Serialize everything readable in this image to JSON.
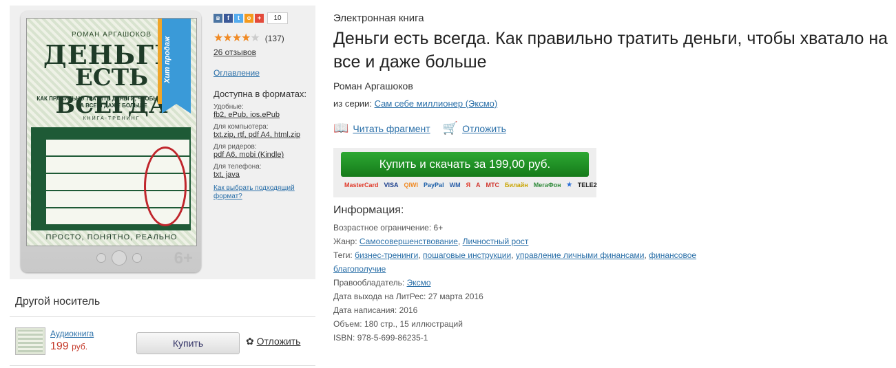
{
  "cover": {
    "author": "РОМАН АРГАШОКОВ",
    "title_line1": "ДЕНЬГИ",
    "title_line2": "ЕСТЬ ВСЕГДА",
    "subtitle": "КАК ПРАВИЛЬНО ТРАТИТЬ ДЕНЬГИ, ЧТОБЫ ХВАТАЛО НА ВСЕ И ДАЖЕ БОЛЬШЕ",
    "kind": "КНИГА-ТРЕНИНГ",
    "motto": "ПРОСТО, ПОНЯТНО, РЕАЛЬНО",
    "ribbon": "Хит продаж",
    "age": "6+"
  },
  "share": {
    "count": "10"
  },
  "rating": {
    "count": "(137)",
    "reviews": "26 отзывов"
  },
  "toc": "Оглавление",
  "formats": {
    "title": "Доступна в форматах:",
    "convenient_label": "Удобные:",
    "convenient": "fb2, ePub, ios.ePub",
    "computer_label": "Для компьютера:",
    "computer": "txt.zip, rtf, pdf A4, html.zip",
    "reader_label": "Для ридеров:",
    "reader": "pdf A6, mobi (Kindle)",
    "phone_label": "Для телефона:",
    "phone": "txt, java",
    "howto": "Как выбрать подходящий формат?"
  },
  "other_media": {
    "title": "Другой носитель",
    "audio_link": "Аудиокнига",
    "audio_price": "199",
    "audio_currency": "руб.",
    "buy_label": "Купить",
    "defer_label": "Отложить"
  },
  "book": {
    "type": "Электронная книга",
    "title": "Деньги есть всегда. Как правильно тратить деньги, чтобы хватало на все и даже больше",
    "author": "Роман Аргашоков",
    "series_prefix": "из серии:",
    "series": "Сам себе миллионер (Эксмо)",
    "read_fragment": "Читать фрагмент",
    "defer": "Отложить",
    "buy_button": "Купить и скачать за 199,00 руб."
  },
  "payments": [
    "MasterCard",
    "VISA",
    "QIWI",
    "PayPal",
    "WM",
    "Я",
    "A",
    "МТС",
    "Билайн",
    "МегаФон",
    "★",
    "TELE2"
  ],
  "info": {
    "heading": "Информация:",
    "age_label": "Возрастное ограничение:",
    "age": "6+",
    "genre_label": "Жанр:",
    "genre1": "Самосовершенствование",
    "genre2": "Личностный рост",
    "tags_label": "Теги:",
    "tag1": "бизнес-тренинги",
    "tag2": "пошаговые инструкции",
    "tag3": "управление личными финансами",
    "tag4": "финансовое благополучие",
    "rights_label": "Правообладатель:",
    "rights": "Эксмо",
    "release_label": "Дата выхода на ЛитРес:",
    "release": "27 марта 2016",
    "written_label": "Дата написания:",
    "written": "2016",
    "volume_label": "Объем:",
    "volume": "180 стр., 15 иллюстраций",
    "isbn_label": "ISBN:",
    "isbn": "978-5-699-86235-1"
  }
}
